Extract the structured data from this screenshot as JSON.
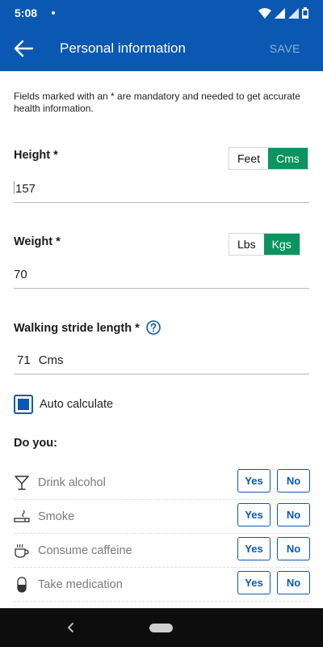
{
  "status_bar": {
    "time": "5:08"
  },
  "header": {
    "title": "Personal information",
    "save_label": "SAVE"
  },
  "note": "Fields marked with an * are mandatory and needed to get accurate health information.",
  "height": {
    "label": "Height *",
    "units": [
      "Feet",
      "Cms"
    ],
    "selected": "Cms",
    "value": "157"
  },
  "weight": {
    "label": "Weight *",
    "units": [
      "Lbs",
      "Kgs"
    ],
    "selected": "Kgs",
    "value": "70"
  },
  "stride": {
    "label": "Walking stride length *",
    "value": "71",
    "unit": "Cms"
  },
  "auto_calculate": {
    "label": "Auto calculate",
    "checked": true
  },
  "do_you": {
    "title": "Do you:",
    "yes_label": "Yes",
    "no_label": "No",
    "items": [
      {
        "label": "Drink alcohol",
        "icon": "cocktail-glass-icon"
      },
      {
        "label": "Smoke",
        "icon": "cigarette-icon"
      },
      {
        "label": "Consume caffeine",
        "icon": "coffee-cup-icon"
      },
      {
        "label": "Take medication",
        "icon": "pill-icon"
      }
    ]
  },
  "colors": {
    "primary": "#0a58b1",
    "active_toggle": "#0a9460",
    "nav_bar": "#0d0d0d"
  }
}
